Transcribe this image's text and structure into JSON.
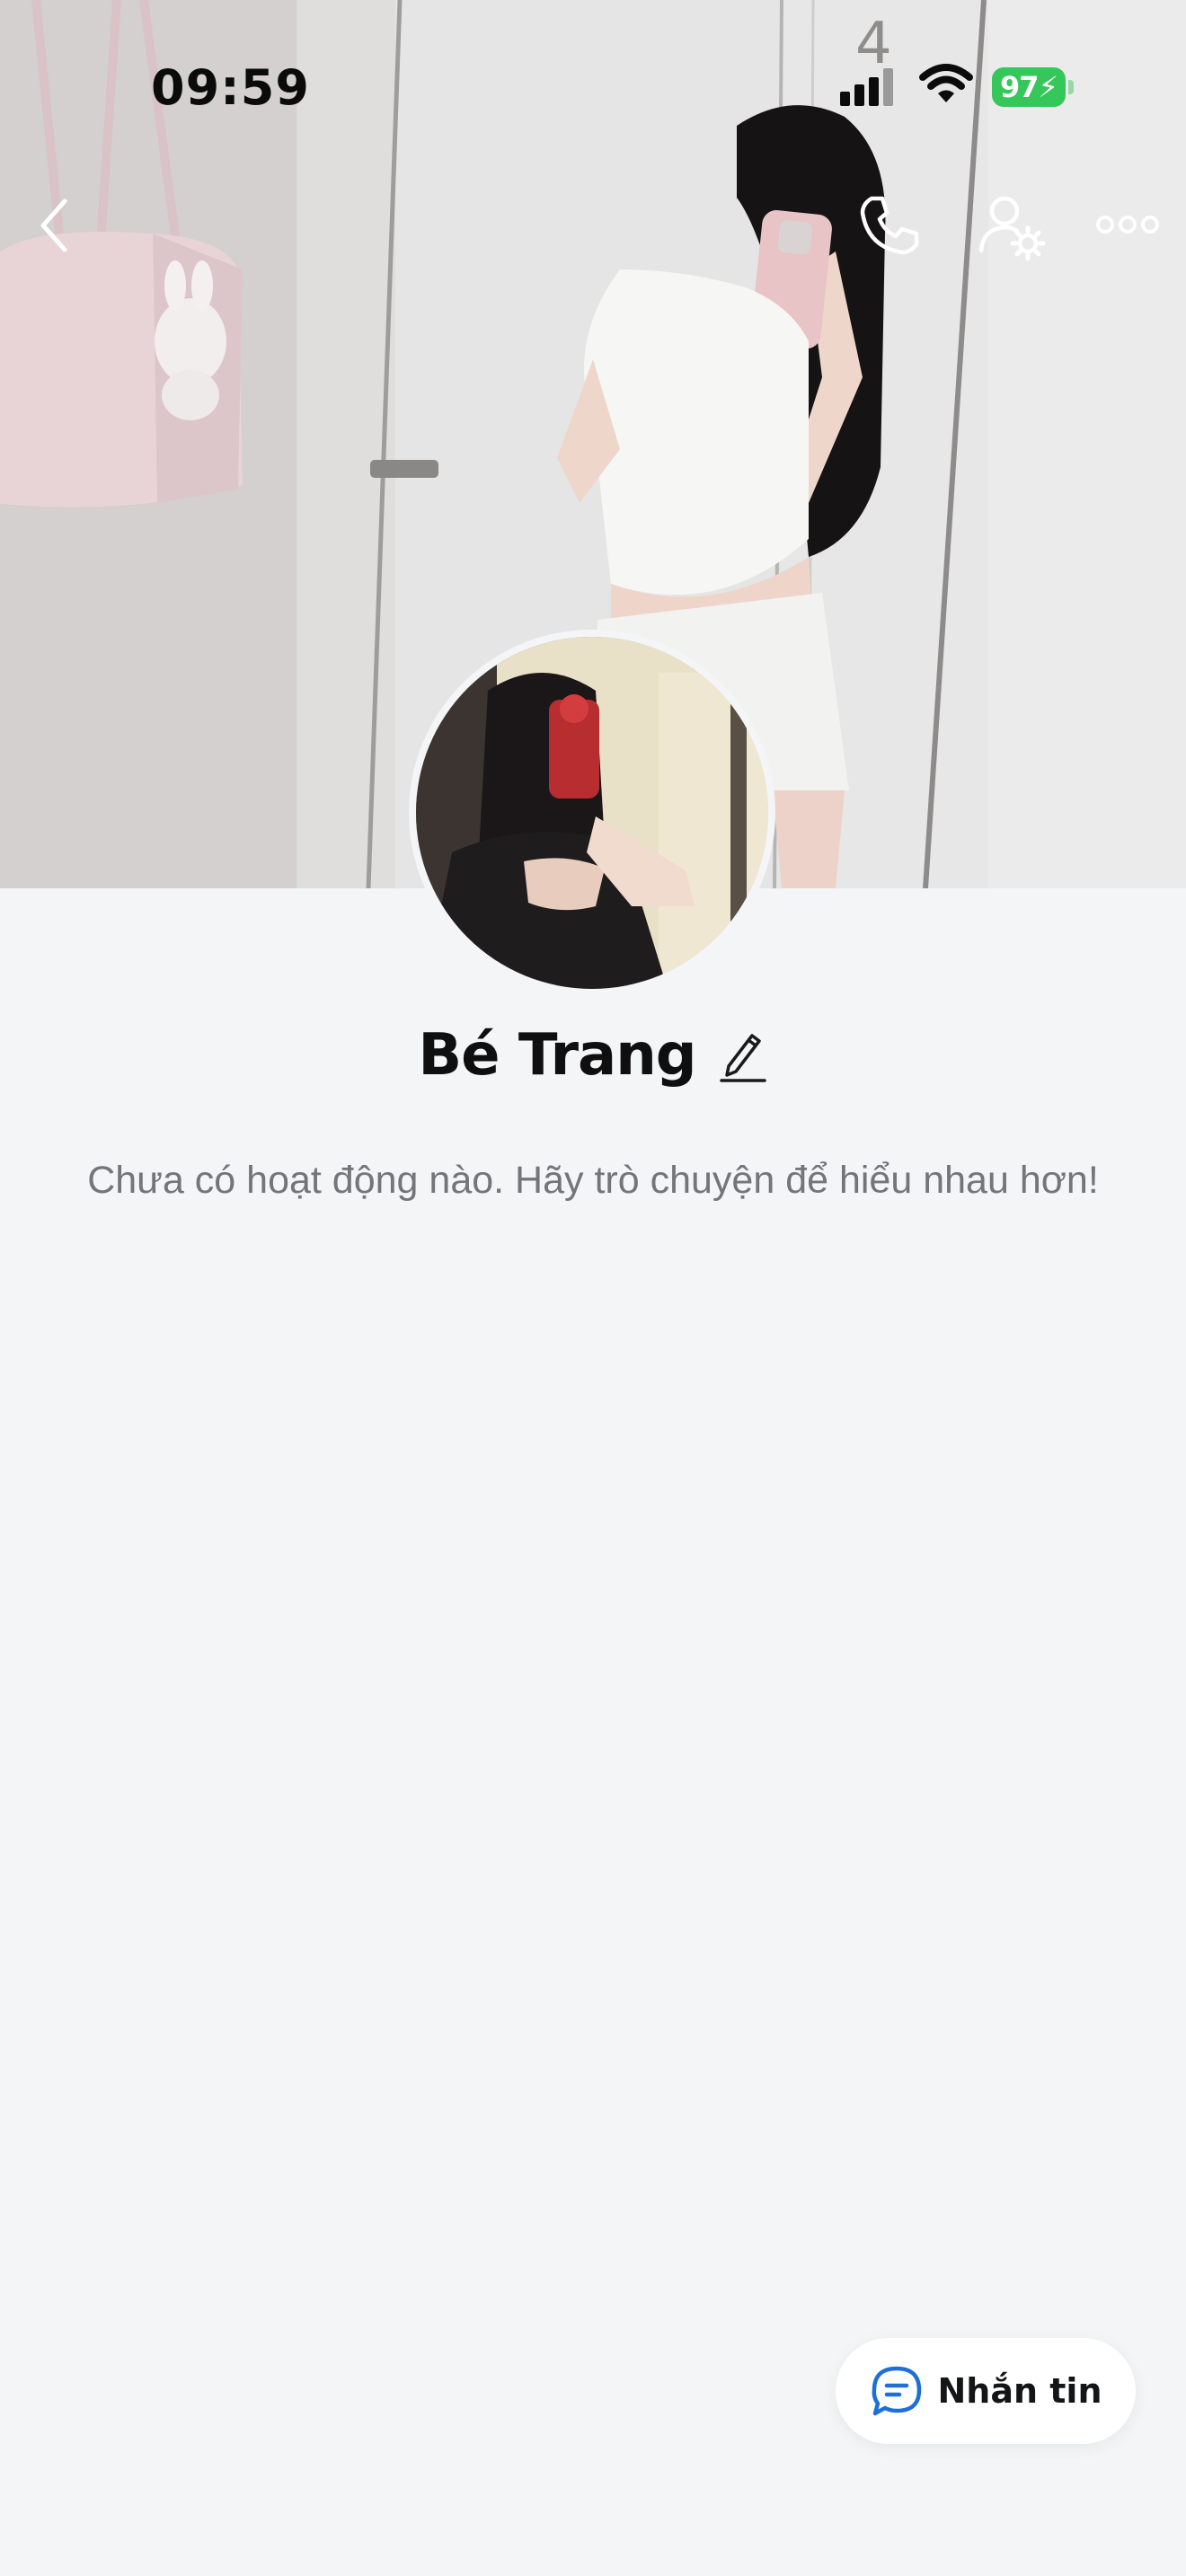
{
  "status_bar": {
    "time": "09:59",
    "battery": "97",
    "icons": [
      "cellular-signal-icon",
      "wifi-icon",
      "battery-charging-icon"
    ]
  },
  "nav": {
    "icons": [
      "chevron-left-icon",
      "phone-icon",
      "user-settings-icon",
      "more-icon"
    ]
  },
  "profile": {
    "name": "Bé Trang",
    "edit_icon": "pencil-icon",
    "empty_activity": "Chưa có hoạt động nào. Hãy trò chuyện để hiểu nhau hơn!"
  },
  "actions": {
    "message_label": "Nhắn tin",
    "message_icon": "chat-bubble-icon"
  },
  "colors": {
    "background": "#f4f5f7",
    "battery": "#35c759",
    "accent": "#1e6fd9"
  }
}
